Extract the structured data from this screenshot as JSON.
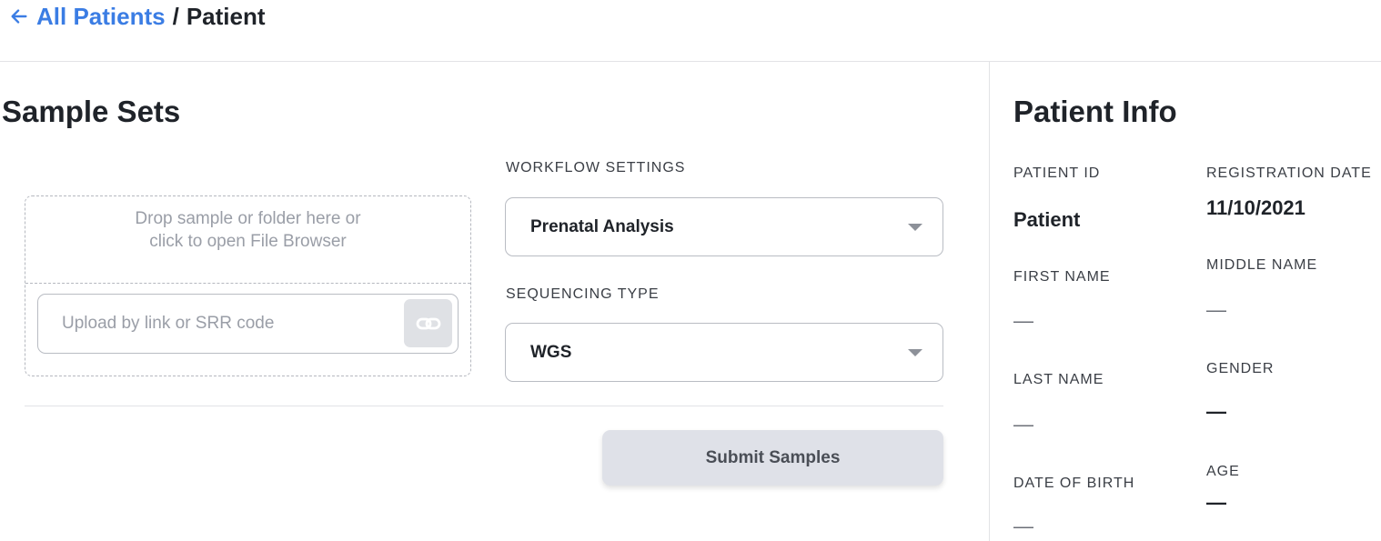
{
  "breadcrumb": {
    "back_label": "All Patients",
    "separator": "/",
    "current": "Patient"
  },
  "sample_sets": {
    "title": "Sample Sets",
    "dropzone_text": "Drop sample or folder here or click to open File Browser",
    "link_input_placeholder": "Upload by link or SRR code",
    "workflow_label": "WORKFLOW SETTINGS",
    "workflow_value": "Prenatal Analysis",
    "sequencing_label": "SEQUENCING TYPE",
    "sequencing_value": "WGS",
    "submit_label": "Submit Samples"
  },
  "patient_info": {
    "title": "Patient Info",
    "patient_id_label": "PATIENT ID",
    "patient_id_value": "Patient",
    "registration_date_label": "REGISTRATION DATE",
    "registration_date_value": "11/10/2021",
    "first_name_label": "FIRST NAME",
    "first_name_value": "—",
    "middle_name_label": "MIDDLE NAME",
    "middle_name_value": "—",
    "last_name_label": "LAST NAME",
    "last_name_value": "—",
    "gender_label": "GENDER",
    "gender_value": "—",
    "dob_label": "DATE OF BIRTH",
    "dob_value": "—",
    "age_label": "AGE",
    "age_value": "—"
  },
  "colors": {
    "accent": "#3b7de4",
    "button_bg": "#dfe1e8"
  }
}
